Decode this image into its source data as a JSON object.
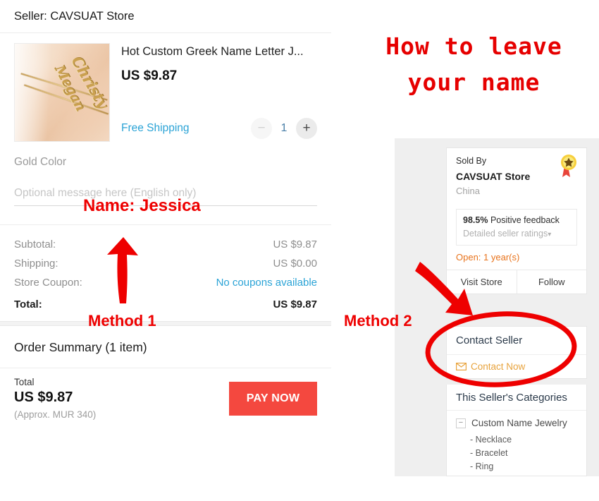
{
  "checkout": {
    "seller_header": "Seller: CAVSUAT Store",
    "product": {
      "title": "Hot Custom Greek Name Letter J...",
      "price": "US $9.87",
      "shipping_label": "Free Shipping",
      "quantity": "1",
      "minus_label": "−",
      "plus_label": "+",
      "variant": "Gold Color",
      "thumb_name_1": "Megan",
      "thumb_name_2": "Christy"
    },
    "message_placeholder": "Optional message here (English only)",
    "totals": [
      {
        "label": "Subtotal:",
        "value": "US $9.87",
        "style": "normal"
      },
      {
        "label": "Shipping:",
        "value": "US $0.00",
        "style": "normal"
      },
      {
        "label": "Store Coupon:",
        "value": "No coupons available",
        "style": "link"
      },
      {
        "label": "Total:",
        "value": "US $9.87",
        "style": "bold"
      }
    ],
    "order_summary_title": "Order Summary (1 item)",
    "pay": {
      "total_label": "Total",
      "total_amount": "US $9.87",
      "approx": "(Approx. MUR 340)",
      "button": "PAY NOW"
    }
  },
  "seller_card": {
    "sold_by_label": "Sold By",
    "store_name": "CAVSUAT Store",
    "country": "China",
    "feedback_percent": "98.5%",
    "feedback_label": "Positive feedback",
    "detailed_ratings": "Detailed seller ratings",
    "open_label": "Open:",
    "open_value": "1 year(s)",
    "visit_store": "Visit Store",
    "follow": "Follow"
  },
  "contact_card": {
    "title": "Contact Seller",
    "contact_now": "Contact Now"
  },
  "categories_card": {
    "title": "This Seller's Categories",
    "root": "Custom Name Jewelry",
    "items": [
      "- Necklace",
      "- Bracelet",
      "- Ring"
    ]
  },
  "annotations": {
    "headline_line1": "How to leave",
    "headline_line2": "your name",
    "name_note": "Name: Jessica",
    "method1": "Method 1",
    "method2": "Method 2",
    "accent_red": "#ee0000",
    "pay_button_color": "#f4483f",
    "link_blue": "#2aa3d6",
    "orange": "#e8731c"
  }
}
